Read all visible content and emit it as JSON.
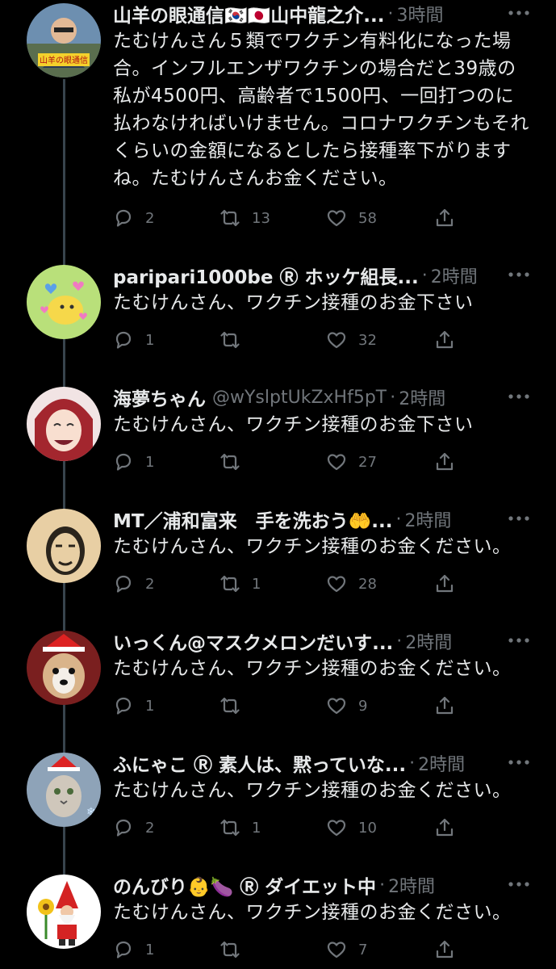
{
  "tweets": [
    {
      "name": "山羊の眼通信🇰🇷🇯🇵山中龍之介...",
      "handle": "",
      "time": "3時間",
      "text": "たむけんさん５類でワクチン有料化になった場合。インフルエンザワクチンの場合だと39歳の私が4500円、高齢者で1500円、一回打つのに払わなければいけません。コロナワクチンもそれくらいの金額になるとしたら接種率下がりますね。たむけんさんお金ください。",
      "reply_count": "2",
      "retweet_count": "13",
      "like_count": "58",
      "avatar_label": "山羊の眼通信"
    },
    {
      "name": "paripari1000be Ⓡ ホッケ組長...",
      "handle": "",
      "time": "2時間",
      "text": "たむけんさん、ワクチン接種のお金下さい",
      "reply_count": "1",
      "retweet_count": "",
      "like_count": "32"
    },
    {
      "name": "海夢ちゃん",
      "handle": "@wYslptUkZxHf5pT",
      "time": "2時間",
      "text": "たむけんさん、ワクチン接種のお金下さい",
      "reply_count": "1",
      "retweet_count": "",
      "like_count": "27"
    },
    {
      "name": "MT／浦和富来　手を洗おう🤲...",
      "handle": "",
      "time": "2時間",
      "text": "たむけんさん、ワクチン接種のお金ください。",
      "reply_count": "2",
      "retweet_count": "1",
      "like_count": "28"
    },
    {
      "name": "いっくん@マスクメロンだいす...",
      "handle": "",
      "time": "2時間",
      "text": "たむけんさん、ワクチン接種のお金ください。",
      "reply_count": "1",
      "retweet_count": "",
      "like_count": "9"
    },
    {
      "name": "ふにゃこ Ⓡ 素人は、黙っていな...",
      "handle": "",
      "time": "2時間",
      "text": "たむけんさん、ワクチン接種のお金ください。",
      "reply_count": "2",
      "retweet_count": "1",
      "like_count": "10"
    },
    {
      "name": "のんびり👶🍆 Ⓡ ダイエット中",
      "handle": "",
      "time": "2時間",
      "text": "たむけんさん、ワクチン接種のお金ください。",
      "reply_count": "1",
      "retweet_count": "",
      "like_count": "7"
    }
  ],
  "dot_separator": "·",
  "colors": {
    "background": "#000000",
    "text": "#e7e9ea",
    "muted": "#71767b",
    "thread_line": "#38444d"
  }
}
